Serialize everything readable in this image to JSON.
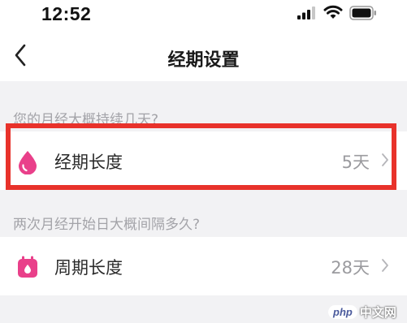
{
  "status_bar": {
    "time": "12:52",
    "signal_icon": "signal-icon",
    "wifi_icon": "wifi-icon",
    "battery_icon": "battery-icon"
  },
  "nav": {
    "back_icon": "chevron-left-icon",
    "title": "经期设置"
  },
  "sections": [
    {
      "label": "您的月经大概持续几天?",
      "row": {
        "icon": "drop-icon",
        "label": "经期长度",
        "value": "5天",
        "chevron": "chevron-right-icon"
      }
    },
    {
      "label": "两次月经开始日大概间隔多久?",
      "row": {
        "icon": "calendar-icon",
        "label": "周期长度",
        "value": "28天",
        "chevron": "chevron-right-icon"
      }
    }
  ],
  "colors": {
    "accent": "#e9408a",
    "highlight": "#e8322b",
    "background": "#f2f2f4"
  },
  "watermark": {
    "logo": "php",
    "text": "中文网"
  }
}
